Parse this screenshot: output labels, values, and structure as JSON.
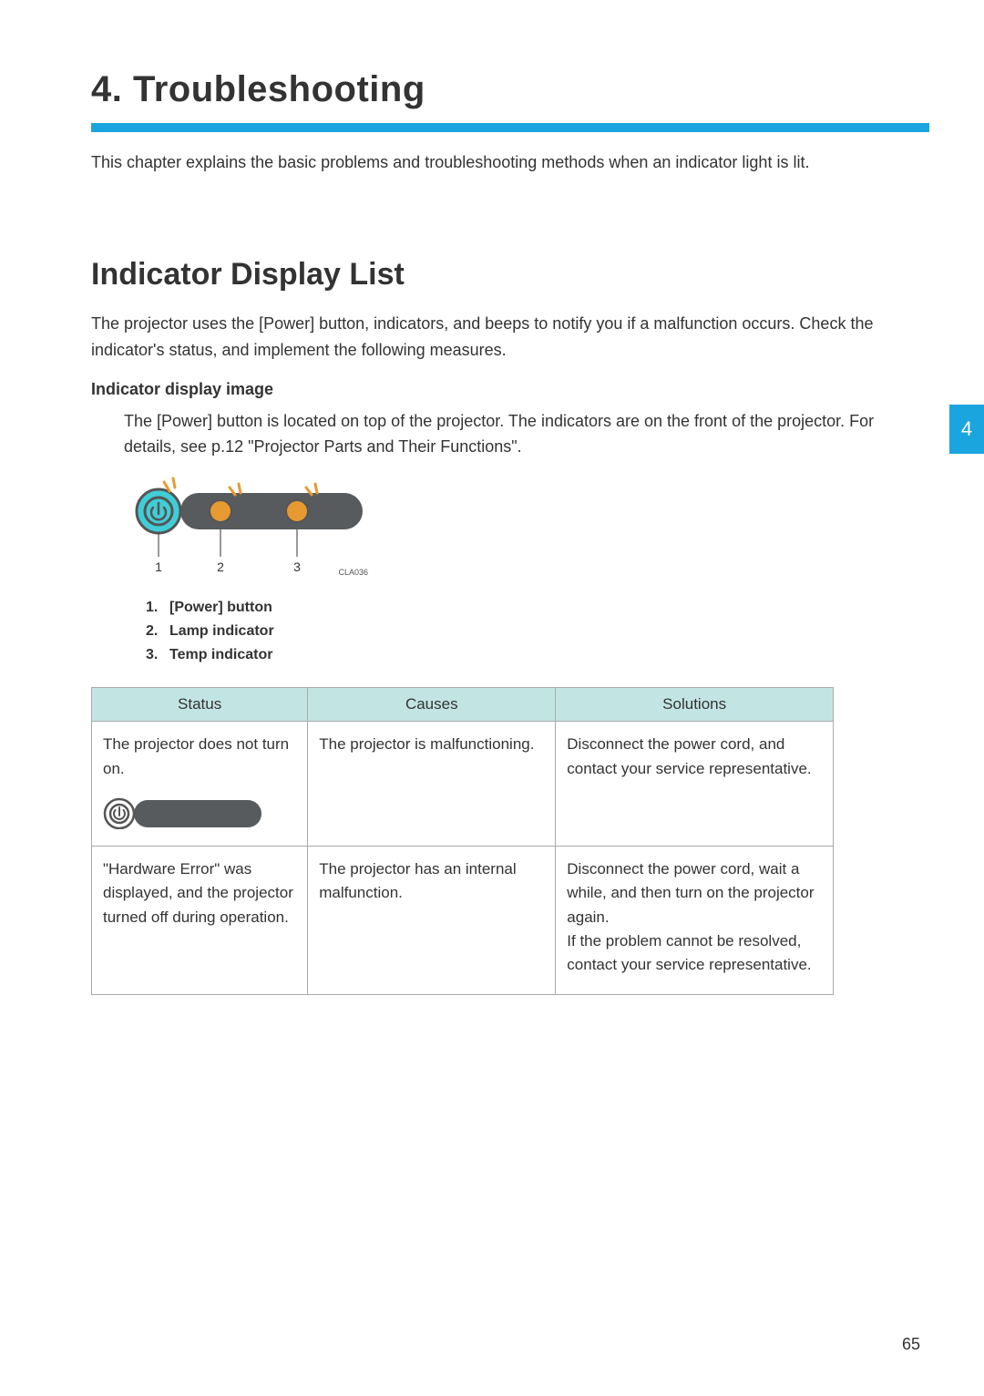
{
  "chapter": {
    "title": "4. Troubleshooting",
    "intro": "This chapter explains the basic problems and troubleshooting methods when an indicator light is lit."
  },
  "section": {
    "title": "Indicator Display List",
    "intro": "The projector uses the [Power] button, indicators, and beeps to notify you if a malfunction occurs. Check the indicator's status, and implement the following measures.",
    "subhead": "Indicator display image",
    "subtext": "The [Power] button is located on top of the projector. The indicators are on the front of the projector. For details, see p.12 \"Projector Parts and Their Functions\".",
    "imageCode": "CLA036",
    "legend": [
      {
        "num": "1.",
        "label": "[Power] button"
      },
      {
        "num": "2.",
        "label": "Lamp indicator"
      },
      {
        "num": "3.",
        "label": "Temp indicator"
      }
    ]
  },
  "sideTab": "4",
  "pageNumber": "65",
  "table": {
    "headers": {
      "status": "Status",
      "causes": "Causes",
      "solutions": "Solutions"
    },
    "rows": [
      {
        "status": "The projector does not turn on.",
        "causes": "The projector is malfunctioning.",
        "solutions": "Disconnect the power cord, and contact your service representative."
      },
      {
        "status": "\"Hardware Error\" was displayed, and the projector turned off during operation.",
        "causes": "The projector has an internal malfunction.",
        "solutions": "Disconnect the power cord, wait a while, and then turn on the projector again.\nIf the problem cannot be resolved, contact your service representative."
      }
    ]
  }
}
